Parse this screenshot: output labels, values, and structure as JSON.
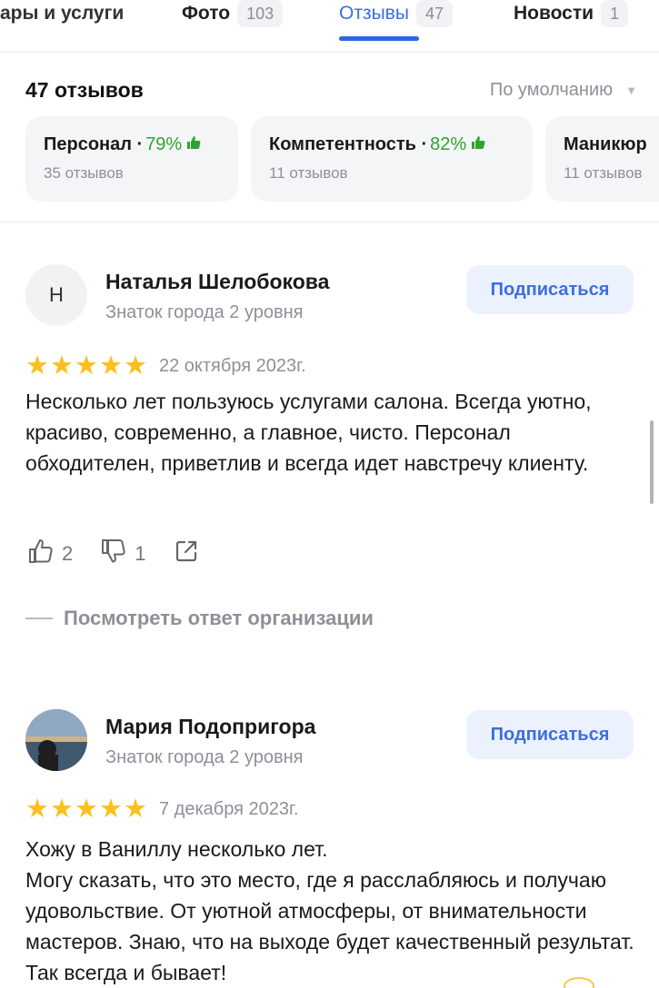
{
  "tabs": [
    {
      "label": "ары и услуги",
      "count": ""
    },
    {
      "label": "Фото",
      "count": "103"
    },
    {
      "label": "Отзывы",
      "count": "47"
    },
    {
      "label": "Новости",
      "count": "1"
    }
  ],
  "summary": {
    "review_count": "47 отзывов",
    "sort_label": "По умолчанию",
    "sort_arrow_icon": "triangle-down"
  },
  "aspects": [
    {
      "title": "Персонал ·",
      "percent": "79%",
      "sub": "35 отзывов"
    },
    {
      "title": "Компетентность ·",
      "percent": "82%",
      "sub": "11 отзывов"
    },
    {
      "title": "Маникюр",
      "percent": "",
      "sub": "11 отзывов"
    }
  ],
  "reviews": [
    {
      "avatar_letter": "Н",
      "author": "Наталья Шелобокова",
      "level": "Знаток города 2 уровня",
      "subscribe_label": "Подписаться",
      "rating": 5,
      "date": "22 октября 2023г.",
      "text": "Несколько лет пользуюсь услугами салона. Всегда уютно, красиво, современно, а главное, чисто. Персонал обходителен, приветлив и всегда идет навстречу клиенту.",
      "likes": "2",
      "dislikes": "1",
      "response_link": "Посмотреть ответ организации"
    },
    {
      "avatar_letter": "",
      "author": "Мария Подопригора",
      "level": "Знаток города 2 уровня",
      "subscribe_label": "Подписаться",
      "rating": 5,
      "date": "7 декабря 2023г.",
      "text_lines": [
        "Хожу в Ваниллу несколько лет.",
        "Могу сказать, что это место, где я расслабляюсь и получаю удовольствие. От уютной атмосферы, от внимательности мастеров. Знаю, что на выходе будет качественный результат. Так всегда и бывает!"
      ]
    }
  ],
  "colors": {
    "accent": "#3d6ee0",
    "star": "#fbbf1f",
    "positive": "#2fa32f",
    "muted": "#8d9096"
  }
}
